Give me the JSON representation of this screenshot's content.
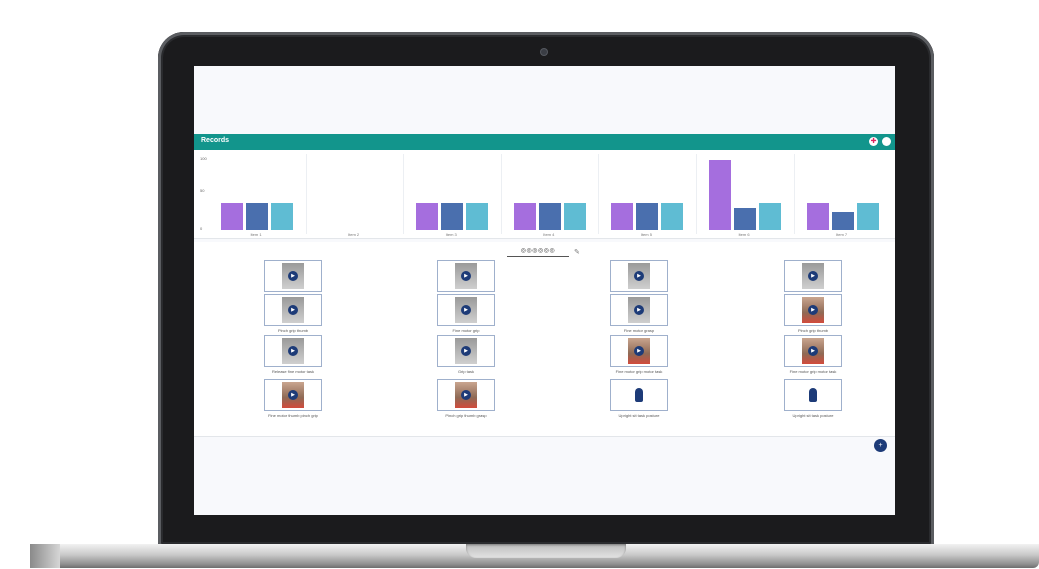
{
  "app": {
    "title": "Records",
    "header_icons": [
      "shield-icon",
      "circle-icon"
    ],
    "accent": "#12958c"
  },
  "chart_data": {
    "type": "bar",
    "y_ticks": [
      "100",
      "50",
      "0"
    ],
    "categories": [
      "Item 1",
      "Item 2",
      "Item 3",
      "Item 4",
      "Item 5",
      "Item 6",
      "Item 7"
    ],
    "series": [
      {
        "color": "#a56ede",
        "values": [
          30,
          0,
          30,
          30,
          30,
          78,
          30
        ]
      },
      {
        "color": "#4a6fae",
        "values": [
          30,
          0,
          30,
          30,
          30,
          25,
          20
        ]
      },
      {
        "color": "#5fbcd3",
        "values": [
          30,
          0,
          30,
          30,
          30,
          30,
          30
        ]
      }
    ],
    "ylim": [
      0,
      80
    ]
  },
  "selector": {
    "value": "◎◎◎◎◎◎"
  },
  "thumbnails": [
    {
      "caption": "Pinch grip",
      "variant": "play"
    },
    {
      "caption": "Fine motor pinch grip",
      "variant": "play"
    },
    {
      "caption": "Pinch grasp fine motor task",
      "variant": "play"
    },
    {
      "caption": "Pinch grip thumb",
      "variant": "play"
    },
    {
      "caption": "Pinch grip thumb",
      "variant": "play"
    },
    {
      "caption": "Fine motor grip",
      "variant": "play"
    },
    {
      "caption": "Fine motor grasp",
      "variant": "play"
    },
    {
      "caption": "Pinch grip thumb",
      "variant": "hand"
    },
    {
      "caption": "Release fine motor task",
      "variant": "play"
    },
    {
      "caption": "Grip task",
      "variant": "play"
    },
    {
      "caption": "Fine motor grip motor task",
      "variant": "hand"
    },
    {
      "caption": "Fine motor grip motor task",
      "variant": "hand"
    },
    {
      "caption": "Fine motor thumb pinch grip",
      "variant": "hand"
    },
    {
      "caption": "Pinch grip thumb grasp",
      "variant": "hand"
    },
    {
      "caption": "Upright sit task posture",
      "variant": "figure"
    },
    {
      "caption": "Upright sit task posture",
      "variant": "figure"
    }
  ],
  "fab": {
    "icon": "plus-icon"
  }
}
